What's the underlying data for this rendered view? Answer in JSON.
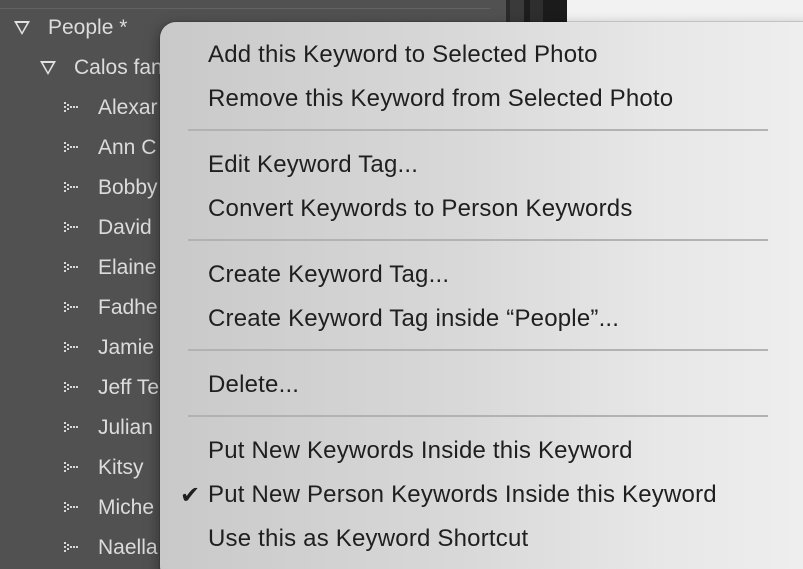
{
  "panel": {
    "root_keyword": "People  *",
    "child_keyword": "Calos fan",
    "keywords": [
      "Alexar",
      "Ann C",
      "Bobby",
      "David",
      "Elaine",
      "Fadhe",
      "Jamie",
      "Jeff Te",
      "Julian",
      "Kitsy",
      "Miche",
      "Naella"
    ]
  },
  "menu": {
    "items": [
      {
        "label": "Add this Keyword to Selected Photo"
      },
      {
        "label": "Remove this Keyword from Selected Photo"
      },
      {
        "label": "Edit Keyword Tag..."
      },
      {
        "label": "Convert Keywords to Person Keywords"
      },
      {
        "label": "Create Keyword Tag..."
      },
      {
        "label": "Create Keyword Tag inside “People”..."
      },
      {
        "label": "Delete..."
      },
      {
        "label": "Put New Keywords Inside this Keyword"
      },
      {
        "label": "Put New Person Keywords Inside this Keyword",
        "checked": true,
        "check_glyph": "✔"
      },
      {
        "label": "Use this as Keyword Shortcut"
      }
    ]
  },
  "icons": {
    "expand_triangle": "disclosure-triangle-icon",
    "person_keyword": "person-keyword-icon",
    "checkmark": "checkmark-icon"
  },
  "colors": {
    "panel_bg": "#515151",
    "panel_text": "#dcdcdc",
    "menu_text": "#1f1f1f",
    "separator": "#b2b2b2"
  }
}
